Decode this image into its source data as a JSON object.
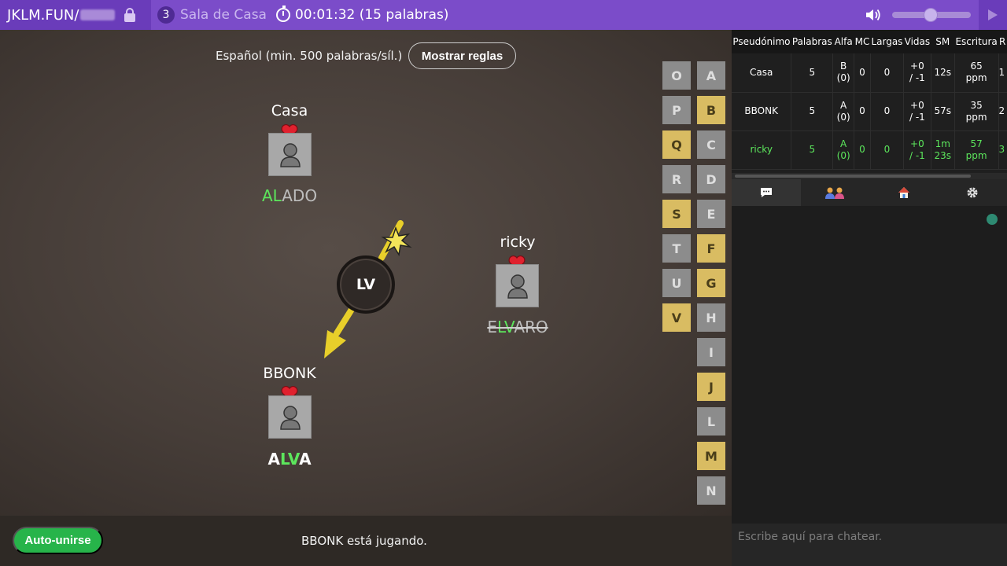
{
  "topbar": {
    "brand": "JKLM.FUN/",
    "room_count": "3",
    "room_name": "Sala de Casa",
    "timer": "00:01:32 (15 palabras)",
    "volume_level": 0.5,
    "accent": "#7b4cc9"
  },
  "game": {
    "language": "Español (min. 500 palabras/síl.)",
    "rules_label": "Mostrar reglas",
    "bomb_syllable": "LV",
    "players": {
      "casa": {
        "name": "Casa",
        "word_hl": "AL",
        "word_rest": "ADO"
      },
      "ricky": {
        "name": "ricky",
        "word_pre": "E",
        "word_hl": "LV",
        "word_rest": "ARO"
      },
      "bbonk": {
        "name": "BBONK",
        "word_pre": "A",
        "word_hl": "LV",
        "word_rest": "A"
      }
    },
    "letters_left": [
      "O",
      "P",
      "Q",
      "R",
      "S",
      "T",
      "U",
      "V"
    ],
    "letters_right": [
      "A",
      "B",
      "C",
      "D",
      "E",
      "F",
      "G",
      "H",
      "I",
      "J",
      "L",
      "M",
      "N"
    ],
    "used_letters": [
      "B",
      "Q",
      "S",
      "F",
      "G",
      "V",
      "J",
      "M"
    ]
  },
  "bottom": {
    "autojoin_label": "Auto-unirse",
    "status": "BBONK está jugando."
  },
  "stats": {
    "headers": [
      "Pseudónimo",
      "Palabras",
      "Alfa",
      "MC",
      "Largas",
      "Vidas",
      "SM",
      "Escritura",
      "R"
    ],
    "rows": [
      {
        "name": "Casa",
        "words": "5",
        "alpha1": "B",
        "alpha2": "(0)",
        "mc": "0",
        "long": "0",
        "lives1": "+0",
        "lives2": "/ -1",
        "sm1": "12s",
        "sm2": "",
        "typing1": "65",
        "typing2": "ppm",
        "r": "1"
      },
      {
        "name": "BBONK",
        "words": "5",
        "alpha1": "A",
        "alpha2": "(0)",
        "mc": "0",
        "long": "0",
        "lives1": "+0",
        "lives2": "/ -1",
        "sm1": "57s",
        "sm2": "",
        "typing1": "35",
        "typing2": "ppm",
        "r": "2"
      },
      {
        "name": "ricky",
        "words": "5",
        "alpha1": "A",
        "alpha2": "(0)",
        "mc": "0",
        "long": "0",
        "lives1": "+0",
        "lives2": "/ -1",
        "sm1": "1m",
        "sm2": "23s",
        "typing1": "57",
        "typing2": "ppm",
        "r": "3"
      }
    ]
  },
  "chat": {
    "placeholder": "Escribe aquí para chatear."
  }
}
